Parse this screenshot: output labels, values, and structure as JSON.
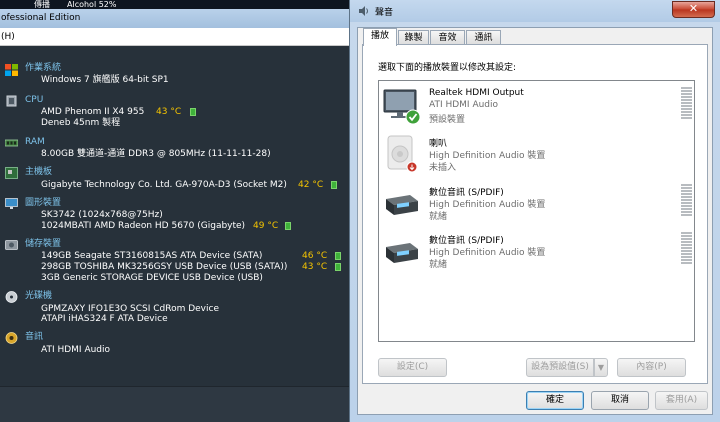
{
  "speccy": {
    "top_strip": {
      "left_text": "傳播",
      "right_text": "Alcohol 52%"
    },
    "title": "ofessional Edition",
    "menu": "(H)",
    "sections": [
      {
        "title": "作業系統",
        "lines": [
          "Windows 7 旗艦版 64-bit SP1"
        ]
      },
      {
        "title": "CPU",
        "lines": [
          "AMD Phenom II X4 955",
          "Deneb 45nm 製程"
        ],
        "temp": "43 °C"
      },
      {
        "title": "RAM",
        "lines": [
          "8.00GB 雙通道-通道 DDR3 @ 805MHz (11-11-11-28)"
        ]
      },
      {
        "title": "主機板",
        "lines": [
          "Gigabyte Technology Co. Ltd. GA-970A-D3 (Socket M2)"
        ],
        "temp": "42 °C"
      },
      {
        "title": "圖形裝置",
        "lines": [
          "SK3742 (1024x768@75Hz)",
          "1024MBATI AMD Radeon HD 5670 (Gigabyte)"
        ],
        "temp": "49 °C"
      },
      {
        "title": "儲存裝置",
        "lines": [
          "149GB Seagate ST3160815AS ATA Device (SATA)",
          "298GB TOSHIBA MK3256GSY USB Device (USB (SATA))",
          "3GB Generic STORAGE DEVICE USB Device (USB)"
        ],
        "temps": [
          "46 °C",
          "43 °C"
        ]
      },
      {
        "title": "光碟機",
        "lines": [
          "GPMZAXY IFO1E3O SCSI CdRom Device",
          "ATAPI iHAS324 F ATA Device"
        ]
      },
      {
        "title": "音訊",
        "lines": [
          "ATI HDMI Audio"
        ]
      }
    ]
  },
  "sound_dialog": {
    "title": "聲音",
    "close_label": "✕",
    "tabs": [
      "播放",
      "錄製",
      "音效",
      "通訊"
    ],
    "instruction": "選取下面的播放裝置以修改其設定:",
    "devices": [
      {
        "name": "Realtek HDMI Output",
        "desc": "ATI HDMI Audio",
        "status": "預設裝置",
        "icon": "monitor-default-icon"
      },
      {
        "name": "喇叭",
        "desc": "High Definition Audio 裝置",
        "status": "未插入",
        "icon": "speaker-unplugged-icon"
      },
      {
        "name": "數位音訊 (S/PDIF)",
        "desc": "High Definition Audio 裝置",
        "status": "就緒",
        "icon": "digital-audio-icon"
      },
      {
        "name": "數位音訊 (S/PDIF)",
        "desc": "High Definition Audio 裝置",
        "status": "就緒",
        "icon": "digital-audio-icon"
      }
    ],
    "buttons": {
      "configure": "設定(C)",
      "set_default": "設為預設值(S)",
      "properties": "內容(P)",
      "ok": "確定",
      "cancel": "取消",
      "apply": "套用(A)"
    }
  },
  "colors": {
    "section_title": "#7ec3ea",
    "temperature": "#f5c400",
    "temp_bar": "#3fb23a"
  }
}
